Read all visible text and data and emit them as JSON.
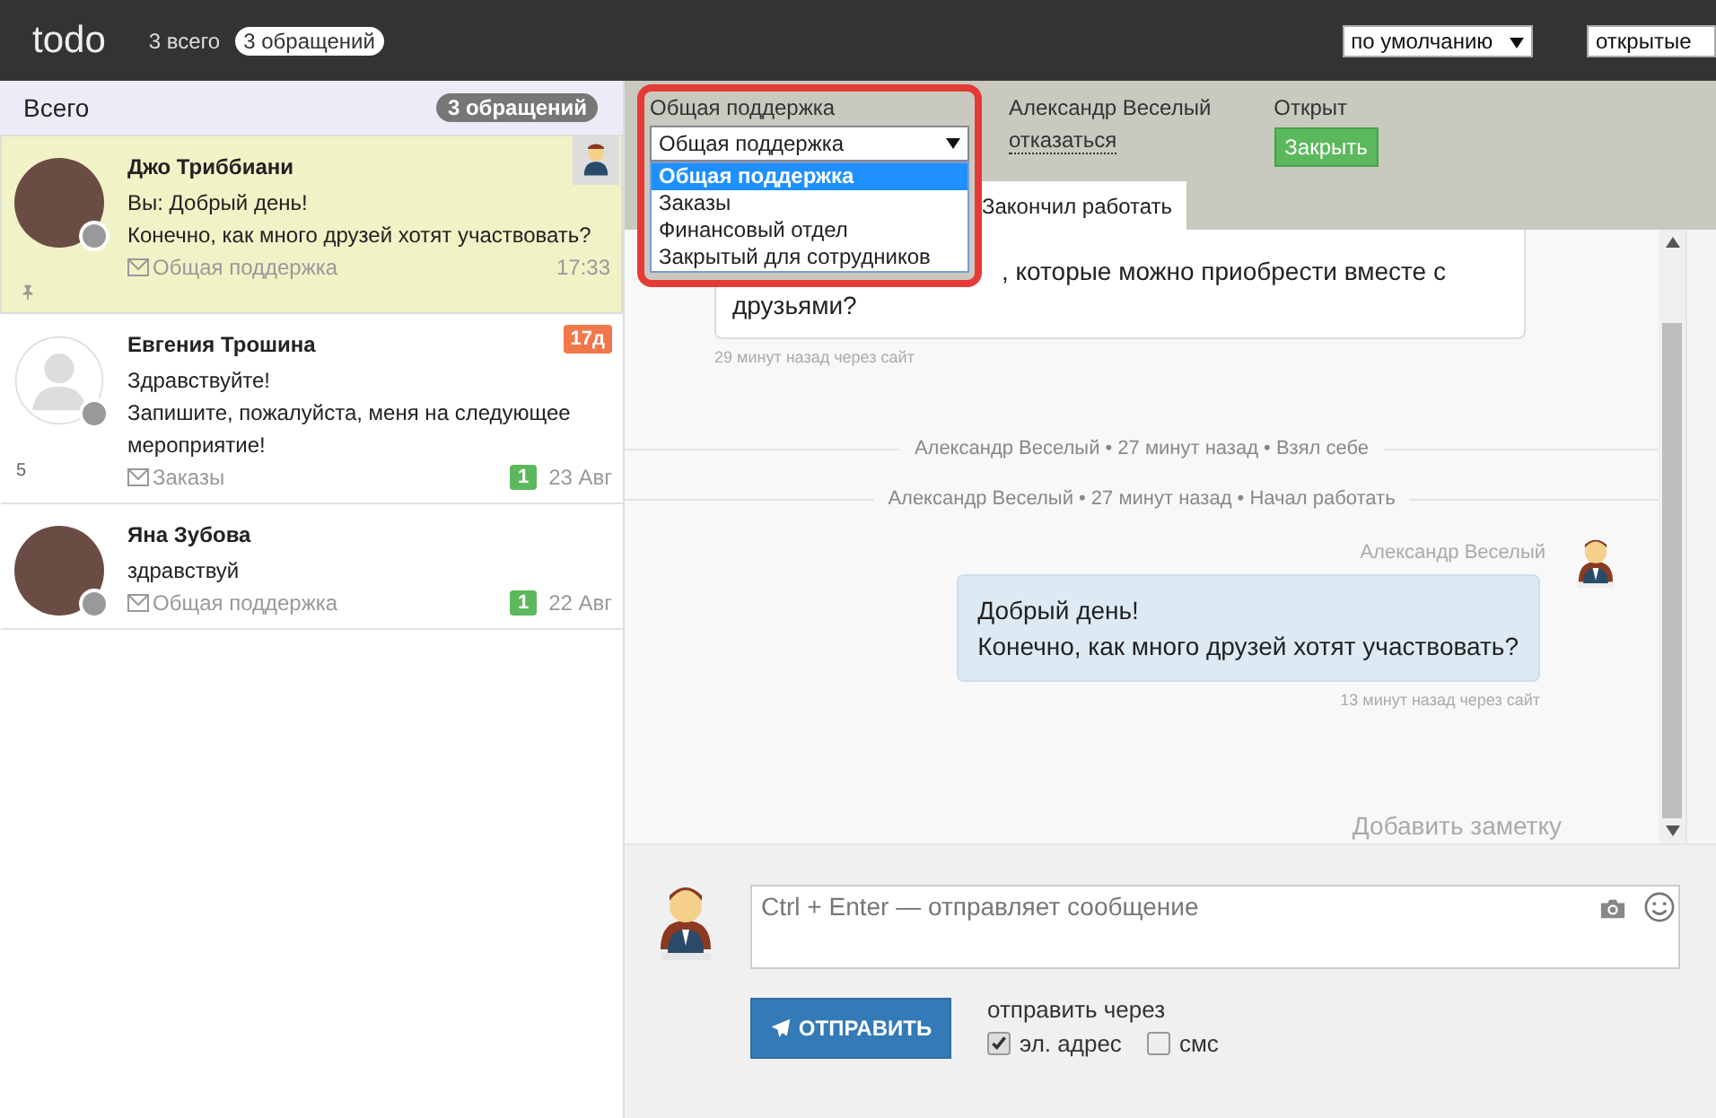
{
  "topbar": {
    "logo": "todo",
    "total": "3 всего",
    "pill": "3 обращений",
    "sort_select": "по умолчанию",
    "filter_select": "открытые"
  },
  "sidebar": {
    "title": "Всего",
    "count": "3 обращений",
    "items": [
      {
        "name": "Джо Триббиани",
        "kind": "photo",
        "lines": [
          "Вы: Добрый день!",
          "Конечно, как много друзей хотят участвовать?"
        ],
        "channel": "Общая поддержка",
        "time": "17:33",
        "selected": true,
        "pinned": true,
        "agent": true
      },
      {
        "name": "Евгения Трошина",
        "kind": "silhouette",
        "lines": [
          "Здравствуйте!",
          "Запишите, пожалуйста, меня на следующее мероприятие!"
        ],
        "channel": "Заказы",
        "time": "23 Авг",
        "unread": "1",
        "age": "17д",
        "side_count": "5",
        "selected": false,
        "pinned": false,
        "agent": false
      },
      {
        "name": "Яна Зубова",
        "kind": "photo",
        "lines": [
          "здравствуй"
        ],
        "channel": "Общая поддержка",
        "time": "22 Авг",
        "unread": "1",
        "selected": false,
        "pinned": false,
        "agent": false
      }
    ]
  },
  "ticket": {
    "department_label": "Общая поддержка",
    "department_value": "Общая поддержка",
    "department_options": [
      {
        "label": "Общая поддержка",
        "selected": true
      },
      {
        "label": "Заказы",
        "selected": false
      },
      {
        "label": "Финансовый отдел",
        "selected": false
      },
      {
        "label": "Закрытый для сотрудников",
        "selected": false
      }
    ],
    "agent_name": "Александр Веселый",
    "agent_action": "отказаться",
    "status_label": "Открыт",
    "status_button": "Закрыть",
    "finish_button": "Закончил работать"
  },
  "messages": [
    {
      "kind": "incoming",
      "text": ", которые можно приобрести вместе с друзьями?",
      "meta": "29 минут назад через сайт"
    },
    {
      "kind": "event",
      "text": "Александр Веселый • 27 минут назад • Взял себе"
    },
    {
      "kind": "event",
      "text": "Александр Веселый • 27 минут назад • Начал работать"
    },
    {
      "kind": "outgoing",
      "author": "Александр Веселый",
      "lines": [
        "Добрый день!",
        "Конечно, как много друзей хотят участвовать?"
      ],
      "meta": "13 минут назад через сайт"
    }
  ],
  "add_note": "Добавить заметку",
  "composer": {
    "placeholder": "Ctrl + Enter — отправляет сообщение",
    "send": "ОТПРАВИТЬ",
    "via_label": "отправить через",
    "channels": [
      {
        "label": "эл. адрес",
        "checked": true
      },
      {
        "label": "смс",
        "checked": false
      }
    ]
  }
}
